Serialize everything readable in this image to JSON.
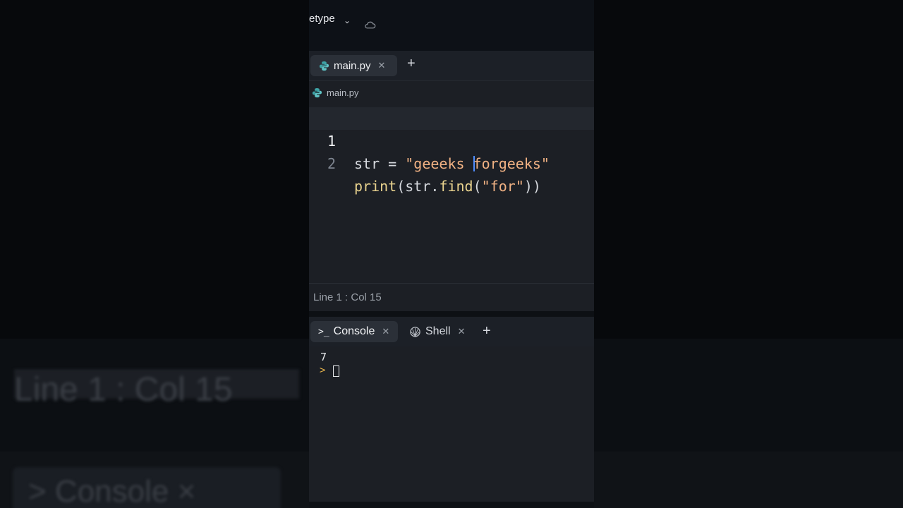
{
  "header": {
    "title_fragment": "etype"
  },
  "editor": {
    "tabs": [
      {
        "label": "main.py"
      }
    ],
    "breadcrumb": "main.py",
    "lines": [
      {
        "number": "1",
        "code": {
          "var": "str",
          "op": " = ",
          "string": "\"geeeks ",
          "string2": "forgeeks\""
        }
      },
      {
        "number": "2",
        "code": {
          "fn": "print",
          "open": "(str.",
          "method": "find",
          "paren": "(",
          "arg": "\"for\"",
          "close": "))"
        }
      }
    ]
  },
  "status": {
    "position": "Line 1 : Col 15"
  },
  "console": {
    "tabs": [
      {
        "label": "Console"
      },
      {
        "label": "Shell"
      }
    ],
    "output": "7",
    "prompt": ">"
  },
  "background_blur": {
    "status": "Line 1 : Col 15",
    "console": "> Console ×"
  },
  "colors": {
    "string": "#f0b183",
    "function": "#e8d28e",
    "prompt": "#e5b34b",
    "caret": "#4f8dff"
  }
}
